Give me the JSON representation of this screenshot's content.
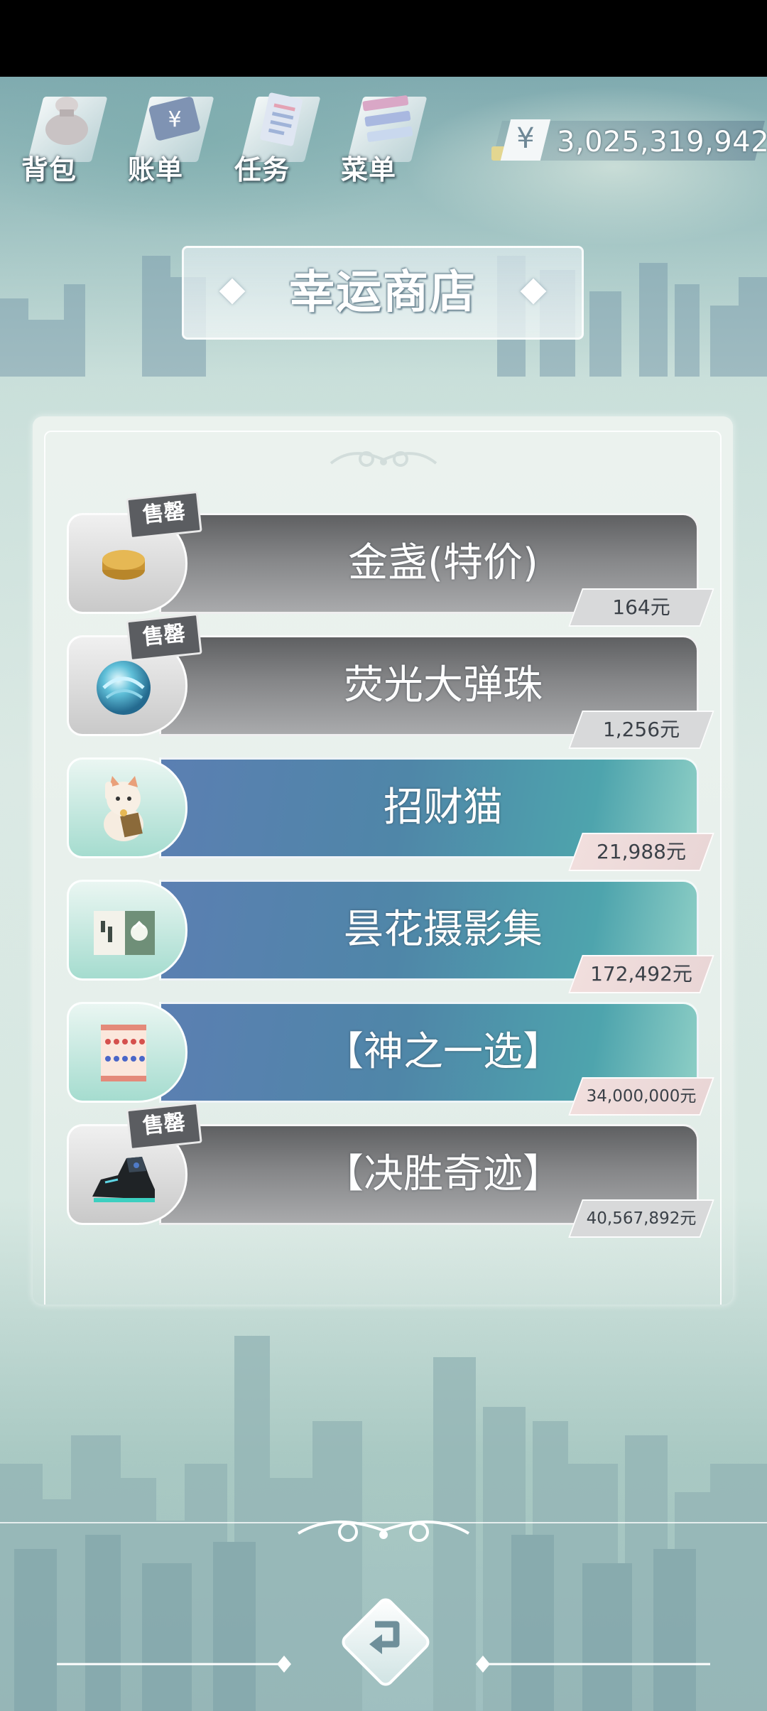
{
  "top_menu": [
    {
      "label": "背包",
      "icon": "bag-icon"
    },
    {
      "label": "账单",
      "icon": "bill-icon"
    },
    {
      "label": "任务",
      "icon": "task-icon"
    },
    {
      "label": "菜单",
      "icon": "menu-icon"
    }
  ],
  "currency": {
    "symbol": "¥",
    "value": "3,025,319,942"
  },
  "title": "幸运商店",
  "items": [
    {
      "name": "金盏(特价)",
      "price": "164元",
      "sold": true,
      "sold_label": "售罄",
      "style": "gray",
      "icon": "gold-coin-icon"
    },
    {
      "name": "荧光大弹珠",
      "price": "1,256元",
      "sold": true,
      "sold_label": "售罄",
      "style": "gray",
      "icon": "marble-icon"
    },
    {
      "name": "招财猫",
      "price": "21,988元",
      "sold": false,
      "style": "blue",
      "icon": "lucky-cat-icon"
    },
    {
      "name": "昙花摄影集",
      "price": "172,492元",
      "sold": false,
      "style": "blue",
      "icon": "photo-book-icon"
    },
    {
      "name": "【神之一选】",
      "price": "34,000,000元",
      "sold": false,
      "style": "blue",
      "icon": "lottery-ticket-icon"
    },
    {
      "name": "【决胜奇迹】",
      "price": "40,567,892元",
      "sold": true,
      "sold_label": "售罄",
      "style": "gray",
      "icon": "sneaker-icon"
    }
  ],
  "back_button": {
    "icon": "back-arrow-icon"
  },
  "colors": {
    "sold_bar": "#858688",
    "available_bar": "#4f86a8",
    "price_tag_sold": "#d8d9da",
    "price_tag_available": "#f1dedd"
  }
}
